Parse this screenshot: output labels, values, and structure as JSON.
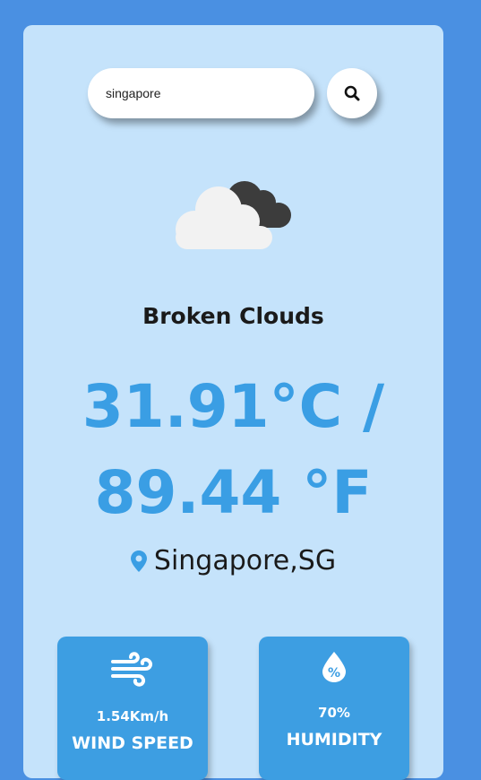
{
  "search": {
    "value": "singapore",
    "icon": "search-icon"
  },
  "weather": {
    "icon": "broken-clouds-icon",
    "description": "Broken Clouds",
    "temp_line1": "31.91°C /",
    "temp_line2": "89.44 °F",
    "location": "Singapore,SG",
    "location_icon": "map-pin-icon"
  },
  "stats": {
    "wind": {
      "icon": "wind-icon",
      "value": "1.54Km/h",
      "label": "WIND SPEED"
    },
    "humidity": {
      "icon": "humidity-icon",
      "value": "70%",
      "label": "HUMIDITY"
    }
  },
  "colors": {
    "page_background": "#4a90e2",
    "card_background": "#c5e3fb",
    "accent": "#3a9ee4",
    "stat_card": "#3d9ee2"
  }
}
